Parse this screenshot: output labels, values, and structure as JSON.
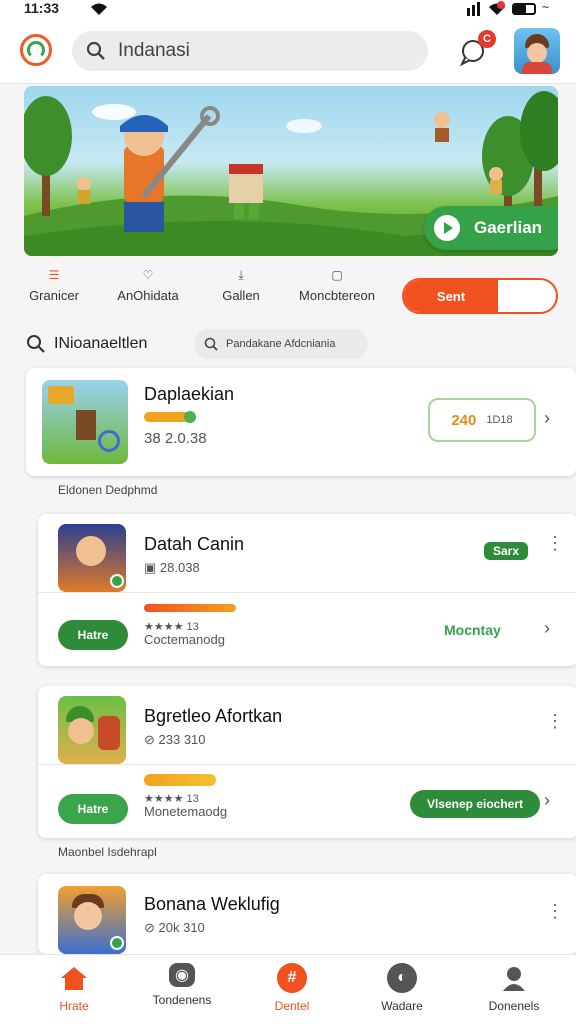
{
  "status": {
    "time": "11:33"
  },
  "search": {
    "value": "Indanasi"
  },
  "notif": {
    "badge": "C"
  },
  "banner": {
    "cta": "Gaerlian"
  },
  "tabs": [
    {
      "label": "Granicer",
      "icon": "menu-icon"
    },
    {
      "label": "AnOhidata",
      "icon": "heart-icon"
    },
    {
      "label": "Gallen",
      "icon": "download-icon"
    },
    {
      "label": "Moncbtereon",
      "icon": "tag-icon"
    }
  ],
  "toggle": {
    "label": "Sent"
  },
  "filter": {
    "label": "INioanaeltlen",
    "chip": "Pandakane Afdcniania"
  },
  "cards": [
    {
      "title": "Daplaekian",
      "meta": "38 2.0.38",
      "badge": "240",
      "badge_sub": "1D18"
    },
    {
      "title": "Datah Canin",
      "meta": "28.038",
      "tag": "Sarx",
      "sub": "Coctemanodg",
      "stars": "★★★★ 13",
      "button": "Hatre",
      "link": "Mocntay"
    },
    {
      "title": "Bgretleo Afortkan",
      "meta": "233 310",
      "sub": "Monetemaodg",
      "stars": "★★★★ 13",
      "button": "Hatre",
      "link": "Vlsenep eiochert"
    },
    {
      "title": "Bonana Weklufig",
      "meta": "20k 310"
    }
  ],
  "labels": {
    "section1": "Eldonen Dedphmd",
    "section2": "Maonbel Isdehrapl"
  },
  "nav": [
    {
      "label": "Hrate",
      "icon": "home-icon",
      "active": true
    },
    {
      "label": "Tondenens",
      "icon": "camera-icon",
      "active": false
    },
    {
      "label": "Dentel",
      "icon": "hashtag-icon",
      "active": true
    },
    {
      "label": "Wadare",
      "icon": "globe-icon",
      "active": false
    },
    {
      "label": "Donenels",
      "icon": "profile-icon",
      "active": false
    }
  ],
  "colors": {
    "accent": "#f1501f",
    "green": "#2e8b3a",
    "banner_green": "#35a24a"
  }
}
